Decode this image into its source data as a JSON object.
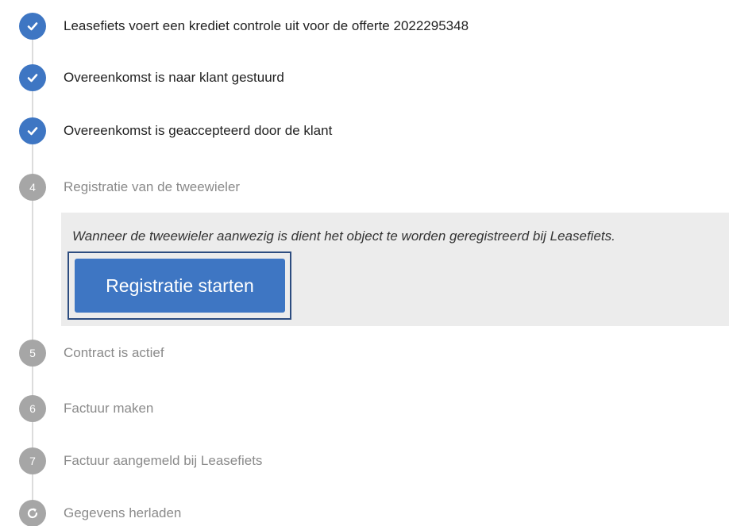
{
  "steps": [
    {
      "status": "done",
      "label": "Leasefiets voert een krediet controle uit voor de offerte 2022295348",
      "icon": "checkmark-icon"
    },
    {
      "status": "done",
      "label": "Overeenkomst is naar klant gestuurd",
      "icon": "checkmark-icon"
    },
    {
      "status": "done",
      "label": "Overeenkomst is geaccepteerd door de klant",
      "icon": "checkmark-icon"
    },
    {
      "status": "active",
      "number": "4",
      "label": "Registratie van de tweewieler"
    },
    {
      "status": "pending",
      "number": "5",
      "label": "Contract is actief"
    },
    {
      "status": "pending",
      "number": "6",
      "label": "Factuur maken"
    },
    {
      "status": "pending",
      "number": "7",
      "label": "Factuur aangemeld bij Leasefiets"
    }
  ],
  "active_panel": {
    "description": "Wanneer de tweewieler aanwezig is dient het object te worden geregistreerd bij Leasefiets.",
    "button_label": "Registratie starten"
  },
  "reload": {
    "label": "Gegevens herladen",
    "icon": "refresh-icon"
  },
  "colors": {
    "accent": "#3e76c3",
    "pending": "#a6a6a6",
    "panel_bg": "#ececec",
    "focus_border": "#2d4d80"
  }
}
